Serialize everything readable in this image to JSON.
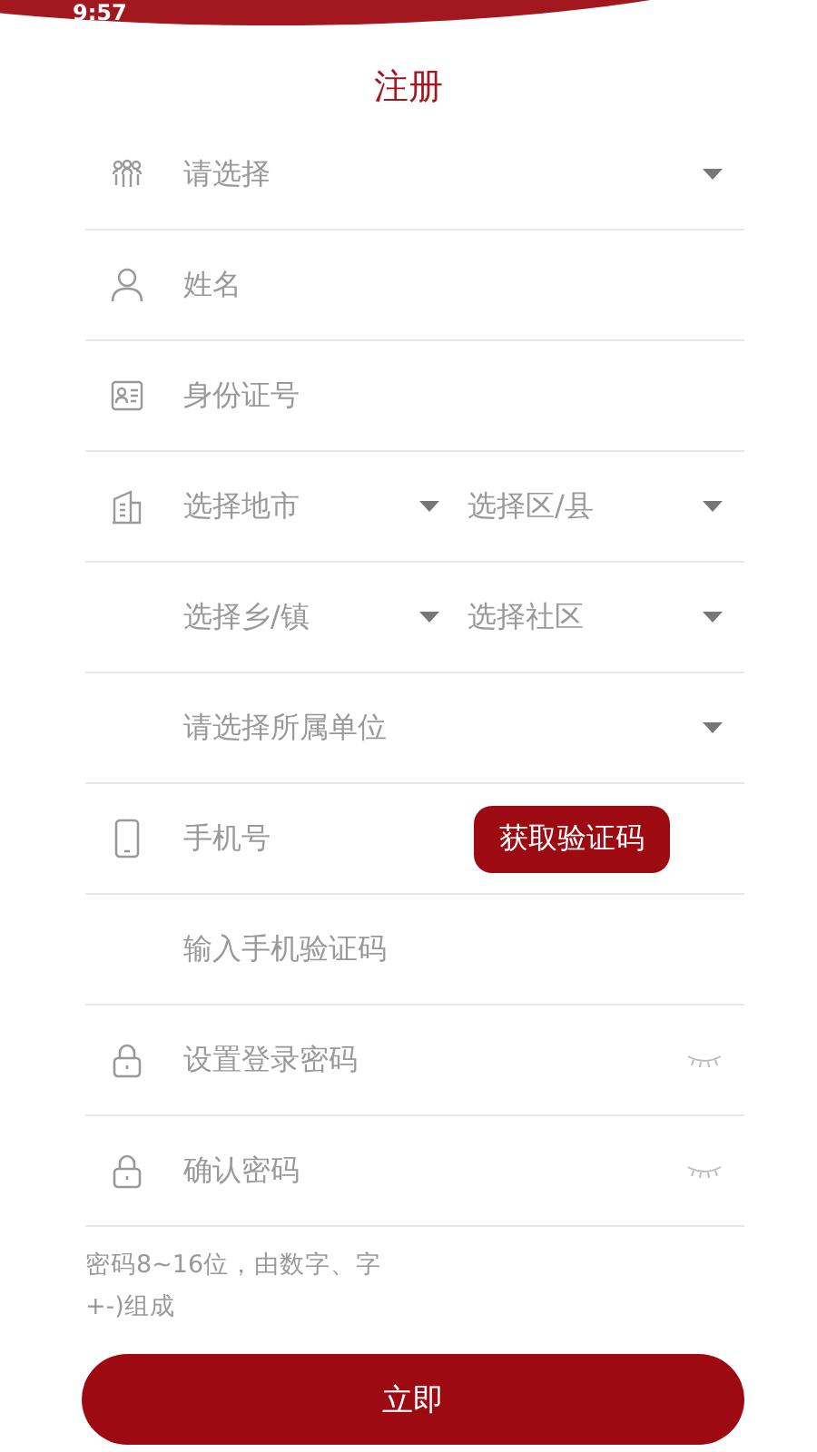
{
  "status_bar": {
    "time": "9:57"
  },
  "title": "注册",
  "rows": [
    {
      "kind": "select",
      "placeholder": "请选择"
    },
    {
      "kind": "input",
      "placeholder": "姓名"
    },
    {
      "kind": "input",
      "placeholder": "身份证号"
    },
    {
      "kind": "pair",
      "placeholders": [
        "选择地市",
        "选择区/县"
      ]
    },
    {
      "kind": "pair",
      "placeholders": [
        "选择乡/镇",
        "选择社区"
      ]
    },
    {
      "kind": "select",
      "placeholder": "请选择所属单位"
    },
    {
      "kind": "code",
      "placeholder": "手机号",
      "button": "获取验证码"
    },
    {
      "kind": "input",
      "placeholder": "输入手机验证码"
    },
    {
      "kind": "password",
      "placeholder": "设置登录密码"
    },
    {
      "kind": "password",
      "placeholder": "确认密码"
    }
  ],
  "hint": [
    "密码8~16位，由数字、字",
    "+-)组成"
  ],
  "submit": "立即"
}
